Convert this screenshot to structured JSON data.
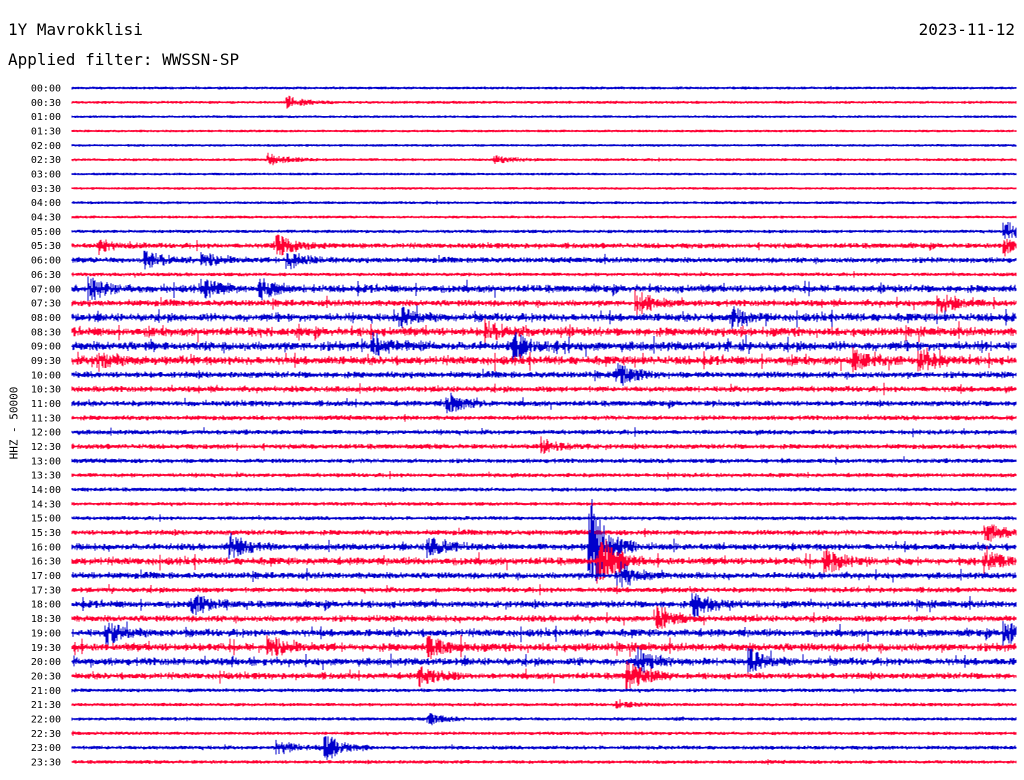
{
  "header": {
    "station": "1Y Mavrokklisi",
    "date": "2023-11-12",
    "filter": "Applied filter: WWSSN-SP"
  },
  "chart_data": {
    "type": "line",
    "title": "1Y Mavrokklisi",
    "ylabel": "HHZ - 50000",
    "rows": [
      "00:00",
      "00:30",
      "01:00",
      "01:30",
      "02:00",
      "02:30",
      "03:00",
      "03:30",
      "04:00",
      "04:30",
      "05:00",
      "05:30",
      "06:00",
      "06:30",
      "07:00",
      "07:30",
      "08:00",
      "08:30",
      "09:00",
      "09:30",
      "10:00",
      "10:30",
      "11:00",
      "11:30",
      "12:00",
      "12:30",
      "13:00",
      "13:30",
      "14:00",
      "14:30",
      "15:00",
      "15:30",
      "16:00",
      "16:30",
      "17:00",
      "17:30",
      "18:00",
      "18:30",
      "19:00",
      "19:30",
      "20:00",
      "20:30",
      "21:00",
      "21:30",
      "22:00",
      "22:30",
      "23:00",
      "23:30"
    ],
    "colors": [
      "#0000cc",
      "#ff0033"
    ],
    "activity": [
      0.3,
      0.3,
      0.2,
      0.2,
      0.2,
      0.3,
      0.2,
      0.2,
      0.3,
      0.3,
      0.5,
      1.2,
      1.3,
      0.6,
      2.0,
      1.6,
      2.2,
      2.4,
      2.6,
      2.4,
      1.6,
      1.4,
      1.3,
      1.0,
      1.0,
      1.1,
      0.9,
      0.8,
      0.7,
      0.6,
      0.7,
      1.2,
      1.7,
      2.0,
      1.6,
      1.2,
      1.8,
      1.6,
      2.0,
      2.2,
      2.0,
      1.6,
      0.6,
      0.5,
      0.5,
      0.5,
      0.7,
      0.6
    ],
    "events": [
      {
        "row": 1,
        "x": 0.23,
        "amp": 6
      },
      {
        "row": 5,
        "x": 0.21,
        "amp": 7
      },
      {
        "row": 5,
        "x": 0.45,
        "amp": 4
      },
      {
        "row": 10,
        "x": 0.99,
        "amp": 10
      },
      {
        "row": 11,
        "x": 0.03,
        "amp": 8
      },
      {
        "row": 11,
        "x": 0.22,
        "amp": 12
      },
      {
        "row": 11,
        "x": 0.99,
        "amp": 9
      },
      {
        "row": 12,
        "x": 0.08,
        "amp": 10
      },
      {
        "row": 12,
        "x": 0.14,
        "amp": 9
      },
      {
        "row": 12,
        "x": 0.23,
        "amp": 10
      },
      {
        "row": 14,
        "x": 0.02,
        "amp": 12
      },
      {
        "row": 14,
        "x": 0.14,
        "amp": 10
      },
      {
        "row": 14,
        "x": 0.2,
        "amp": 9
      },
      {
        "row": 15,
        "x": 0.6,
        "amp": 12
      },
      {
        "row": 15,
        "x": 0.92,
        "amp": 10
      },
      {
        "row": 16,
        "x": 0.35,
        "amp": 10
      },
      {
        "row": 16,
        "x": 0.7,
        "amp": 12
      },
      {
        "row": 17,
        "x": 0.44,
        "amp": 10
      },
      {
        "row": 18,
        "x": 0.32,
        "amp": 10
      },
      {
        "row": 18,
        "x": 0.47,
        "amp": 12
      },
      {
        "row": 19,
        "x": 0.03,
        "amp": 10
      },
      {
        "row": 19,
        "x": 0.83,
        "amp": 12
      },
      {
        "row": 19,
        "x": 0.9,
        "amp": 10
      },
      {
        "row": 20,
        "x": 0.58,
        "amp": 11
      },
      {
        "row": 22,
        "x": 0.4,
        "amp": 11
      },
      {
        "row": 25,
        "x": 0.5,
        "amp": 9
      },
      {
        "row": 31,
        "x": 0.97,
        "amp": 10
      },
      {
        "row": 32,
        "x": 0.17,
        "amp": 14
      },
      {
        "row": 32,
        "x": 0.38,
        "amp": 12
      },
      {
        "row": 33,
        "x": 0.56,
        "amp": 28
      },
      {
        "row": 33,
        "x": 0.8,
        "amp": 14
      },
      {
        "row": 33,
        "x": 0.97,
        "amp": 12
      },
      {
        "row": 32,
        "x": 0.55,
        "amp": 60
      },
      {
        "row": 34,
        "x": 0.58,
        "amp": 14
      },
      {
        "row": 36,
        "x": 0.13,
        "amp": 12
      },
      {
        "row": 36,
        "x": 0.66,
        "amp": 14
      },
      {
        "row": 37,
        "x": 0.62,
        "amp": 14
      },
      {
        "row": 38,
        "x": 0.04,
        "amp": 12
      },
      {
        "row": 38,
        "x": 0.99,
        "amp": 12
      },
      {
        "row": 39,
        "x": 0.21,
        "amp": 14
      },
      {
        "row": 39,
        "x": 0.38,
        "amp": 12
      },
      {
        "row": 40,
        "x": 0.6,
        "amp": 14
      },
      {
        "row": 40,
        "x": 0.72,
        "amp": 12
      },
      {
        "row": 41,
        "x": 0.59,
        "amp": 18
      },
      {
        "row": 41,
        "x": 0.37,
        "amp": 10
      },
      {
        "row": 43,
        "x": 0.58,
        "amp": 4
      },
      {
        "row": 44,
        "x": 0.38,
        "amp": 6
      },
      {
        "row": 46,
        "x": 0.22,
        "amp": 8
      },
      {
        "row": 46,
        "x": 0.27,
        "amp": 14
      }
    ]
  }
}
